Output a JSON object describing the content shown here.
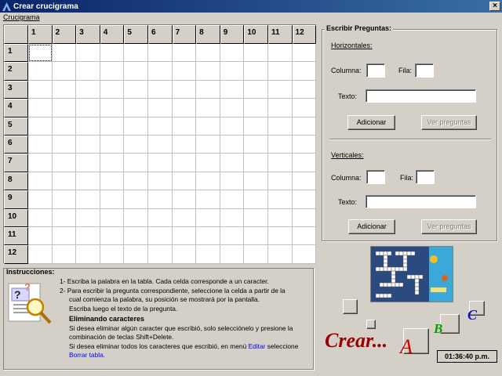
{
  "window": {
    "title": "Crear crucigrama",
    "close_glyph": "×"
  },
  "menu": {
    "item": "Crucigrama"
  },
  "grid": {
    "columns": [
      "1",
      "2",
      "3",
      "4",
      "5",
      "6",
      "7",
      "8",
      "9",
      "10",
      "11",
      "12"
    ],
    "rows": [
      "1",
      "2",
      "3",
      "4",
      "5",
      "6",
      "7",
      "8",
      "9",
      "10",
      "11",
      "12"
    ]
  },
  "questions": {
    "title": "Escribir Preguntas:",
    "horizontal": {
      "heading": "Horizontales:",
      "column_label": "Columna:",
      "row_label": "Fila:",
      "text_label": "Texto:",
      "column_value": "",
      "row_value": "",
      "text_value": "",
      "add_label": "Adicionar",
      "view_label": "Ver preguntas"
    },
    "vertical": {
      "heading": "Verticales:",
      "column_label": "Columna:",
      "row_label": "Fila:",
      "text_label": "Texto:",
      "column_value": "",
      "row_value": "",
      "text_value": "",
      "add_label": "Adicionar",
      "view_label": "Ver preguntas"
    }
  },
  "instructions": {
    "title": "Instrucciones:",
    "l1": "1-  Escriba la palabra en la tabla. Cada celda corresponde a un caracter.",
    "l2": "2-  Para escribir la pregunta correspondiente, seleccione la celda a partir de la",
    "l3": "cual comienza la palabra, su posición se mostrará por la pantalla.",
    "l4": "Escriba luego el texto de la pregunta.",
    "l5": "Eliminando caracteres",
    "l6": "Si desea eliminar algún caracter que escribió, solo selecciónelo y presione la",
    "l7": "combinación de teclas Shift+Delete.",
    "l8a": "Si desea eliminar todos los caracteres que escribió, en menú ",
    "l8b": "Editar",
    "l8c": " seleccione",
    "l9": "Borrar tabla."
  },
  "logo": {
    "crear": "Crear...",
    "a": "A",
    "b": "B",
    "c": "C"
  },
  "clock": "01:36:40 p.m."
}
